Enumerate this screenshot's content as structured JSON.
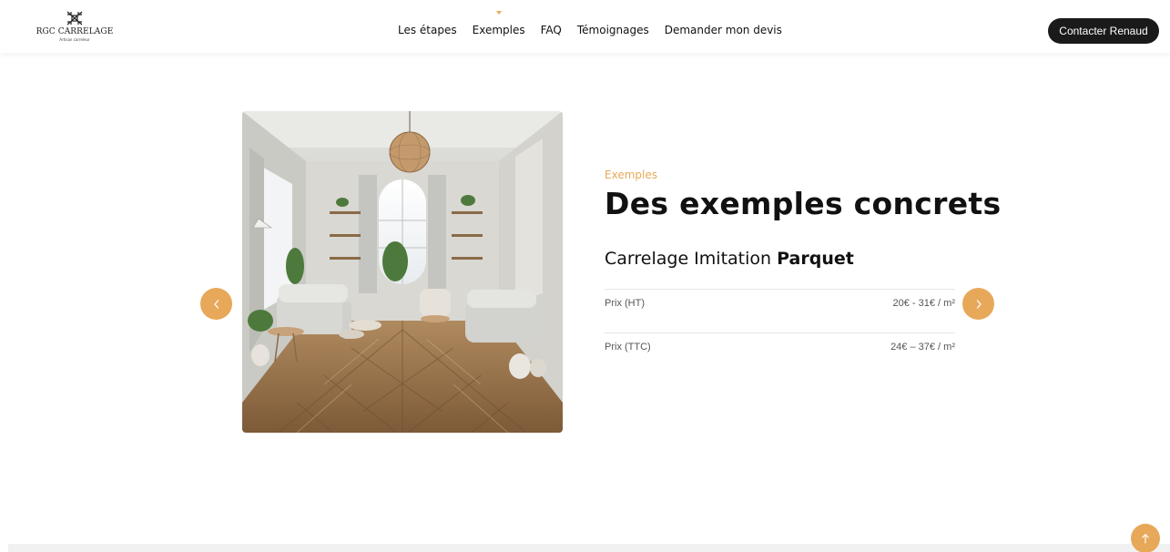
{
  "brand": {
    "name": "RGC CARRELAGE",
    "tagline": "Artisan carreleur"
  },
  "nav": {
    "items": [
      "Les étapes",
      "Exemples",
      "FAQ",
      "Témoignages",
      "Demander mon devis"
    ],
    "active": "Exemples"
  },
  "header": {
    "cta_label": "Contacter Renaud"
  },
  "section": {
    "eyebrow": "Exemples",
    "title": "Des exemples concrets",
    "product_prefix": "Carrelage Imitation",
    "product_emphasis": "Parquet",
    "prices": [
      {
        "label": "Prix (HT)",
        "value": "20€ - 31€ / m²"
      },
      {
        "label": "Prix (TTC)",
        "value": "24€ – 37€ / m²"
      }
    ]
  },
  "colors": {
    "accent": "#e8a85a",
    "dark": "#1a1a1a"
  },
  "icons": {
    "prev": "chevron-left-icon",
    "next": "chevron-right-icon",
    "top": "arrow-up-icon"
  }
}
